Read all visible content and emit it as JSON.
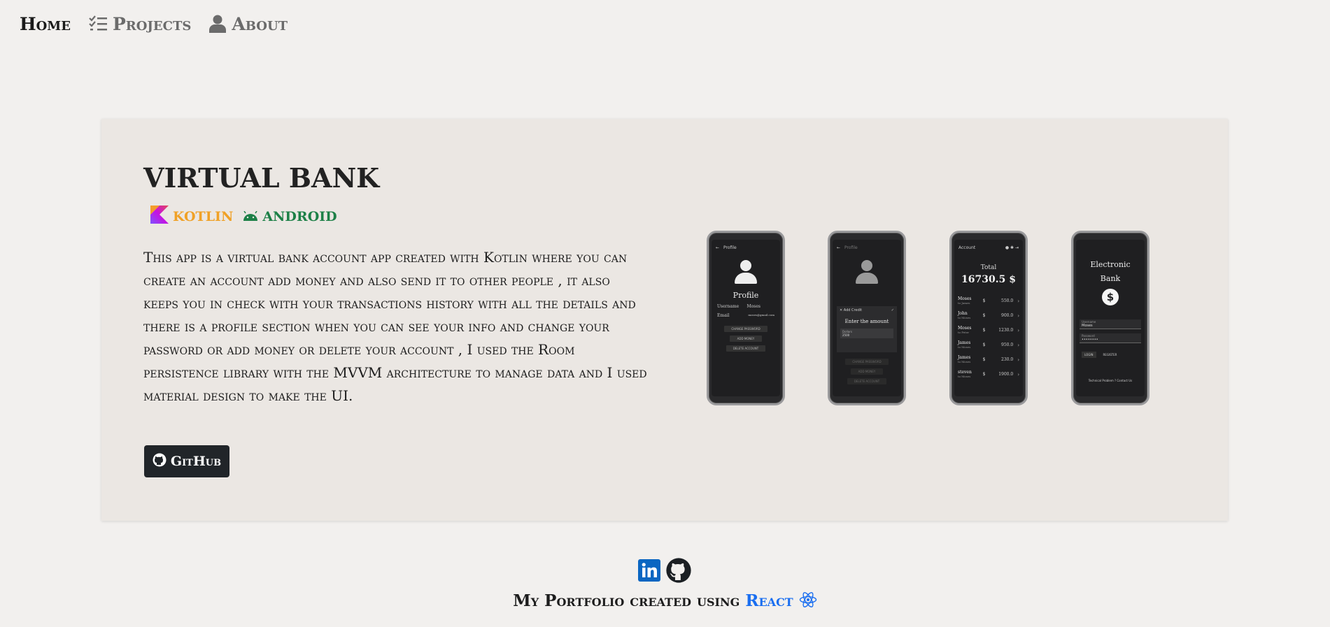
{
  "nav": {
    "items": [
      {
        "label": "Home",
        "icon": "home",
        "active": true
      },
      {
        "label": "Projects",
        "icon": "checklist-icon",
        "active": false
      },
      {
        "label": "About",
        "icon": "user-icon",
        "active": false
      }
    ]
  },
  "project": {
    "title": "VIRTUAL BANK",
    "tags": [
      {
        "label": "KOTLIN",
        "icon": "kotlin-logo-icon",
        "color": "#f0a126"
      },
      {
        "label": "ANDROID",
        "icon": "android-icon",
        "color": "#1d8047"
      }
    ],
    "description": "This app is a virtual bank account app created with Kotlin where you can create an account add money and also send it to other people , it also keeps you in check with your transactions history with all the details and there is a profile section when you can see your info and change your password or add money or delete your account , I used the Room persistence library with the MVVM architecture to manage data and I used material design to make the UI.",
    "github_button": "GitHub"
  },
  "screens": {
    "profile": {
      "appbar": "Profile",
      "title": "Profile",
      "username_label": "Username",
      "username_value": "Moses",
      "email_label": "Email",
      "email_value": "moses@gmail.com",
      "buttons": [
        "CHANGE PASSWORD",
        "ADD MONEY",
        "DELETE ACCOUNT"
      ]
    },
    "add_credit": {
      "appbar": "Profile",
      "dialog_title": "Add Credit",
      "dialog_prompt": "Enter the amount",
      "input_label": "Dollars",
      "input_value": "2500"
    },
    "account": {
      "appbar": "Account",
      "total_label": "Total",
      "total_value": "16730.5 $",
      "transactions": [
        {
          "name": "Moses",
          "sub": "to James",
          "currency": "$",
          "amount": "550.0"
        },
        {
          "name": "John",
          "sub": "to Moses",
          "currency": "$",
          "amount": "900.0"
        },
        {
          "name": "Moses",
          "sub": "to Peter",
          "currency": "$",
          "amount": "1230.0"
        },
        {
          "name": "James",
          "sub": "to Moses",
          "currency": "$",
          "amount": "950.0"
        },
        {
          "name": "James",
          "sub": "to Moses",
          "currency": "$",
          "amount": "230.0"
        },
        {
          "name": "steven",
          "sub": "to Moses",
          "currency": "$",
          "amount": "1900.0"
        }
      ]
    },
    "login": {
      "title_line1": "Electronic",
      "title_line2": "Bank",
      "username_label": "Username",
      "username_value": "Moses",
      "password_label": "Password",
      "password_value": "••••••••",
      "login_button": "LOGIN",
      "register_button": "REGISTER",
      "footer": "Technical Problem ? Contact Us"
    }
  },
  "footer": {
    "text": "My Portfolio created using",
    "link": "React",
    "icons": [
      "linkedin-icon",
      "github-icon",
      "react-icon"
    ]
  },
  "colors": {
    "background": "#f2f0ee",
    "card": "#ebe7e3",
    "kotlin": "#f0a126",
    "android": "#1d8047",
    "react": "#1a6ef0",
    "button": "#212529"
  }
}
